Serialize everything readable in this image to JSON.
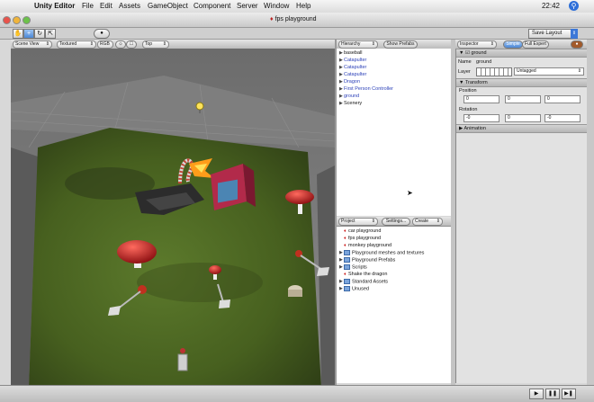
{
  "menubar": {
    "app_name": "Unity Editor",
    "items": [
      "File",
      "Edit",
      "Assets",
      "GameObject",
      "Component",
      "Server",
      "Window",
      "Help"
    ],
    "clock": "22:42"
  },
  "window": {
    "title": "fps playground"
  },
  "toolbar": {
    "tools": [
      "hand",
      "move",
      "rotate",
      "scale"
    ],
    "layout_label": "Save Layout"
  },
  "scene_view": {
    "view_mode": "Scene View",
    "render_mode": "Textured",
    "camera": "Top"
  },
  "hierarchy": {
    "tab_label": "Hierarchy",
    "show_prefabs_label": "Show Prefabs",
    "items": [
      {
        "label": "baseball",
        "color": "black"
      },
      {
        "label": "Catapulter",
        "color": "blue"
      },
      {
        "label": "Catapulter",
        "color": "blue"
      },
      {
        "label": "Catapulter",
        "color": "blue"
      },
      {
        "label": "Dragon",
        "color": "blue"
      },
      {
        "label": "First Person Controller",
        "color": "blue"
      },
      {
        "label": "ground",
        "color": "blue"
      },
      {
        "label": "Scenery",
        "color": "black"
      }
    ]
  },
  "project": {
    "tab_label": "Project",
    "settings_label": "Settings...",
    "create_label": "Create",
    "items": [
      {
        "label": "car playground",
        "kind": "scene"
      },
      {
        "label": "fps playground",
        "kind": "scene"
      },
      {
        "label": "monkey playground",
        "kind": "scene"
      },
      {
        "label": "Playground meshes and textures",
        "kind": "folder"
      },
      {
        "label": "Playground Prefabs",
        "kind": "folder"
      },
      {
        "label": "Scripts",
        "kind": "folder"
      },
      {
        "label": "Shake the dragon",
        "kind": "scene"
      },
      {
        "label": "Standard Assets",
        "kind": "folder"
      },
      {
        "label": "Unused",
        "kind": "folder"
      }
    ]
  },
  "inspector": {
    "tab_label": "Inspector",
    "simple_label": "Simple",
    "full_expert_label": "Full Expert",
    "object_name": "ground",
    "name_label": "Name",
    "name_value": "ground",
    "layer_label": "Layer",
    "layer_value": "Untagged",
    "transform_label": "Transform",
    "position_label": "Position",
    "position": [
      "0",
      "0",
      "0"
    ],
    "rotation_label": "Rotation",
    "rotation": [
      "-0",
      "0",
      "-0"
    ],
    "animation_label": "Animation"
  },
  "colors": {
    "accent": "#3c78d8",
    "hierarchy_link": "#2a3fb8",
    "grass": "#4e6a2a",
    "floor": "#7c7c7c",
    "mushroom": "#c8262a"
  }
}
